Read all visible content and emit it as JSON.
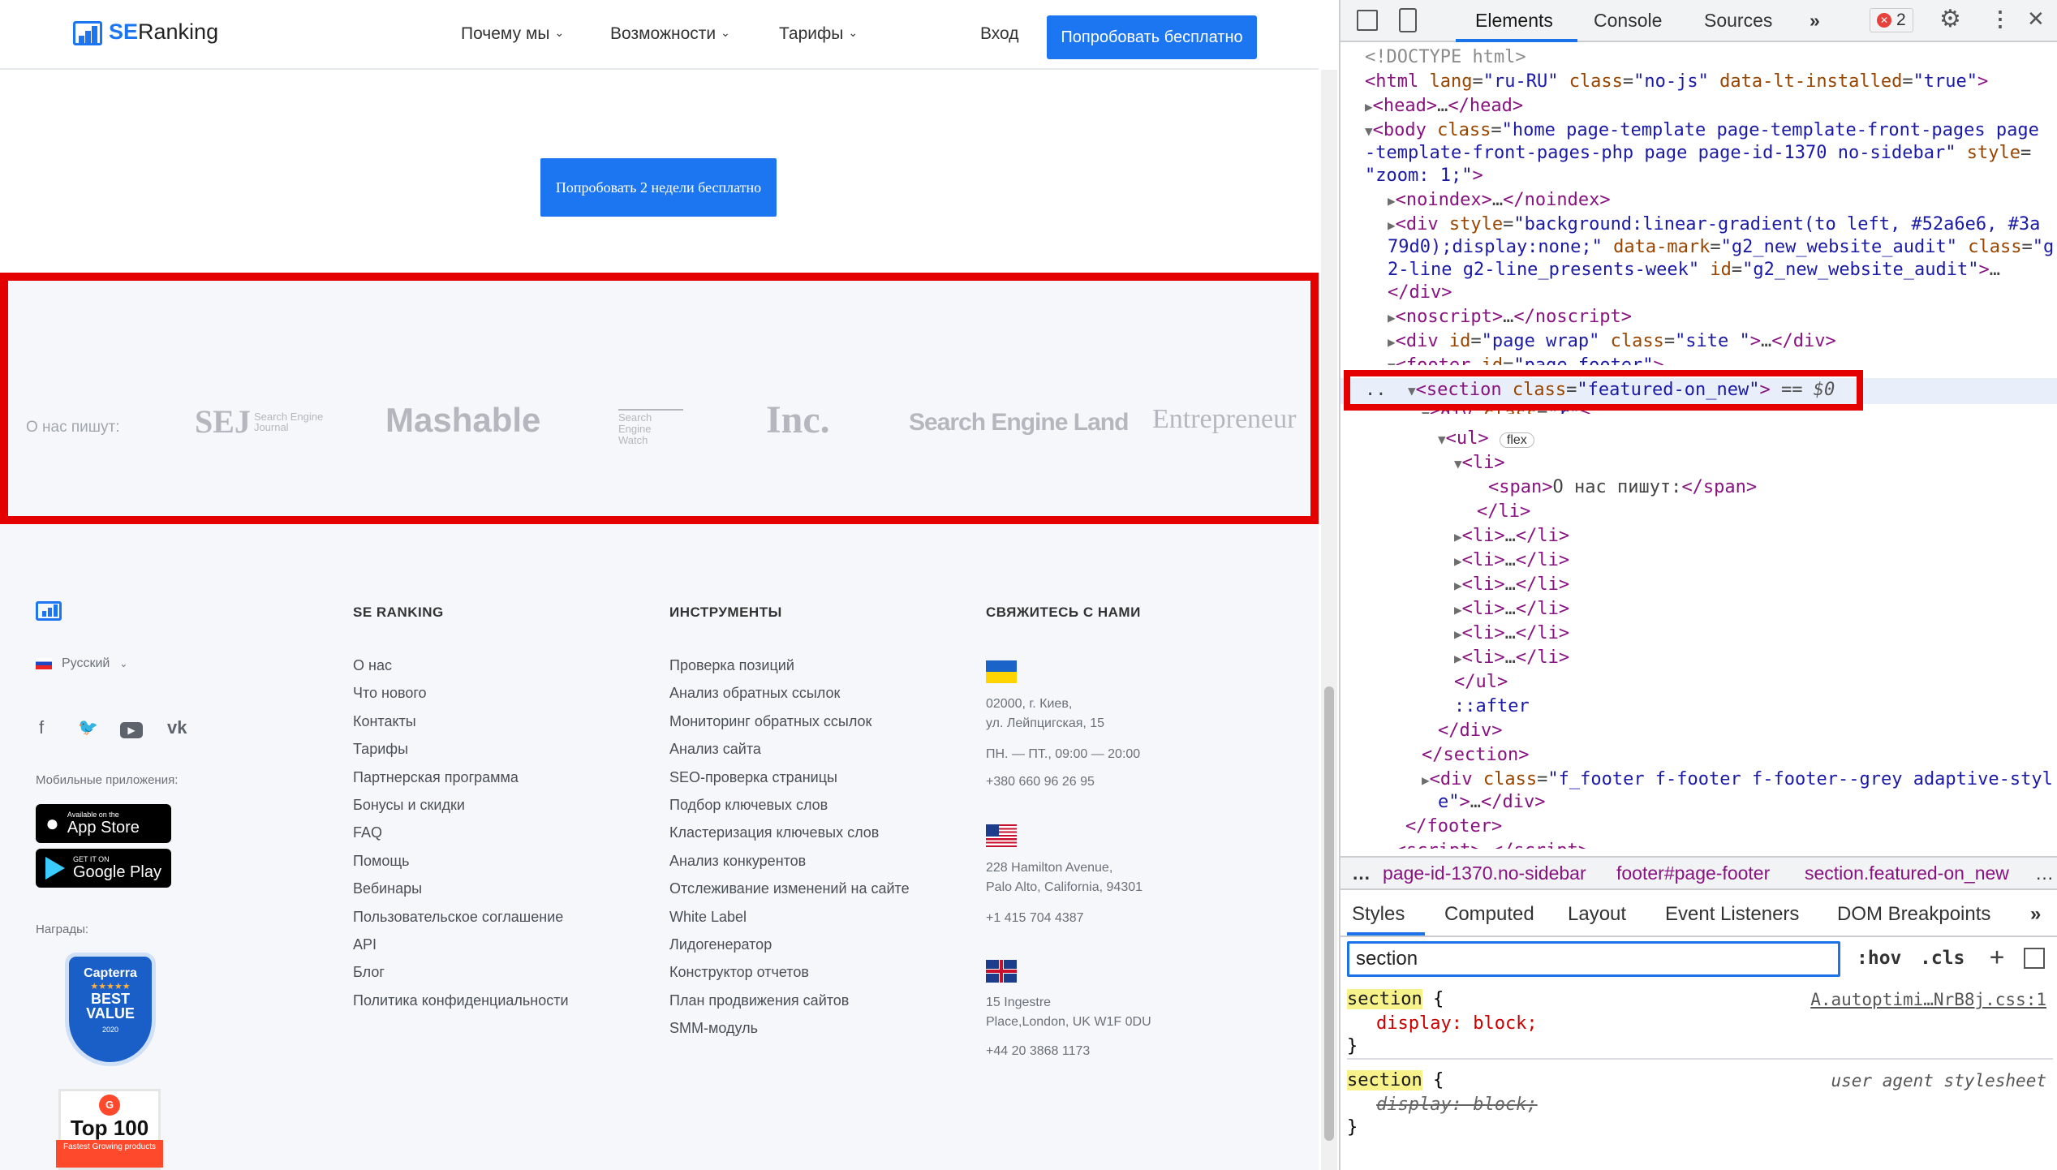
{
  "header": {
    "logo_prefix": "SE",
    "logo_suffix": "Ranking",
    "nav": [
      "Почему мы",
      "Возможности",
      "Тарифы"
    ],
    "login": "Вход",
    "cta": "Попробовать бесплатно"
  },
  "hero_cta": "Попробовать 2 недели бесплатно",
  "featured": {
    "label": "О нас пишут:",
    "publications": [
      "SEJ",
      "Search Engine Journal",
      "Mashable",
      "Search Engine Watch",
      "Inc.",
      "Search Engine Land",
      "Entrepreneur"
    ]
  },
  "footer": {
    "language": "Русский",
    "mobile_apps_label": "Мобильные приложения:",
    "app_store": {
      "small": "Available on the",
      "big": "App Store"
    },
    "google_play": {
      "small": "GET IT ON",
      "big": "Google Play"
    },
    "awards_label": "Награды:",
    "capterra": {
      "brand": "Capterra",
      "line1": "BEST",
      "line2": "VALUE",
      "year": "2020"
    },
    "g2": {
      "title": "Top 100",
      "sub": "Fastest Growing products"
    },
    "col1": {
      "heading": "SE RANKING",
      "links": [
        "О нас",
        "Что нового",
        "Контакты",
        "Тарифы",
        "Партнерская программа",
        "Бонусы и скидки",
        "FAQ",
        "Помощь",
        "Вебинары",
        "Пользовательское соглашение",
        "API",
        "Блог",
        "Политика конфиденциальности"
      ]
    },
    "col2": {
      "heading": "ИНСТРУМЕНТЫ",
      "links": [
        "Проверка позиций",
        "Анализ обратных ссылок",
        "Мониторинг обратных ссылок",
        "Анализ сайта",
        "SEO-проверка страницы",
        "Подбор ключевых слов",
        "Кластеризация ключевых слов",
        "Анализ конкурентов",
        "Отслеживание изменений на сайте",
        "White Label",
        "Лидогенератор",
        "Конструктор отчетов",
        "План продвижения сайтов",
        "SMM-модуль"
      ]
    },
    "col3": {
      "heading": "СВЯЖИТЕСЬ С НАМИ",
      "ua_addr1": "02000, г. Киев,",
      "ua_addr2": "ул. Лейпцигская, 15",
      "ua_hours": "ПН. — ПТ., 09:00 — 20:00",
      "ua_phone": "+380 660 96 26 95",
      "us_addr1": "228 Hamilton Avenue,",
      "us_addr2": "Palo Alto, California, 94301",
      "us_phone": "+1 415 704 4387",
      "uk_addr1": "15 Ingestre",
      "uk_addr2": "Place,London, UK W1F 0DU",
      "uk_phone": "+44 20 3868 1173"
    }
  },
  "devtools": {
    "tabs": [
      "Elements",
      "Console",
      "Sources"
    ],
    "error_count": "2",
    "breadcrumbs": [
      "page-id-1370.no-sidebar",
      "footer#page-footer",
      "section.featured-on_new"
    ],
    "subtabs": [
      "Styles",
      "Computed",
      "Layout",
      "Event Listeners",
      "DOM Breakpoints"
    ],
    "filter_value": "section",
    "hov": ":hov",
    "cls": ".cls",
    "rule1_selector": "section",
    "rule1_prop": "display: block;",
    "rule1_source": "A.autoptimi…NrB8j.css:1",
    "rule2_selector": "section",
    "rule2_prop": "display: block;",
    "rule2_source": "user agent stylesheet"
  }
}
